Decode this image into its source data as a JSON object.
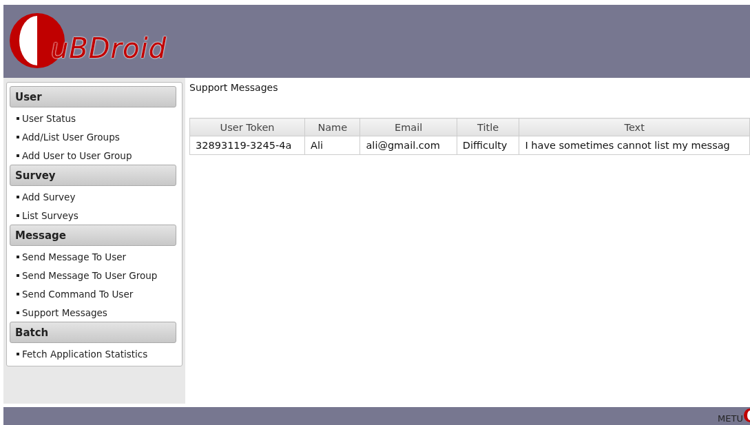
{
  "header": {
    "logo_text": "uBDroid"
  },
  "sidebar": {
    "sections": [
      {
        "title": "User",
        "items": [
          "User Status",
          "Add/List User Groups",
          "Add User to User Group"
        ]
      },
      {
        "title": "Survey",
        "items": [
          "Add Survey",
          "List Surveys"
        ]
      },
      {
        "title": "Message",
        "items": [
          "Send Message To User",
          "Send Message To User Group",
          "Send Command To User",
          "Support Messages"
        ]
      },
      {
        "title": "Batch",
        "items": [
          "Fetch Application Statistics"
        ]
      }
    ]
  },
  "content": {
    "title": "Support Messages",
    "table": {
      "columns": [
        "User Token",
        "Name",
        "Email",
        "Title",
        "Text"
      ],
      "rows": [
        [
          "32893119-3245-4a",
          "Ali",
          "ali@gmail.com",
          "Difficulty",
          "I have sometimes cannot list my messag"
        ]
      ]
    }
  },
  "footer": {
    "text": "METU"
  }
}
